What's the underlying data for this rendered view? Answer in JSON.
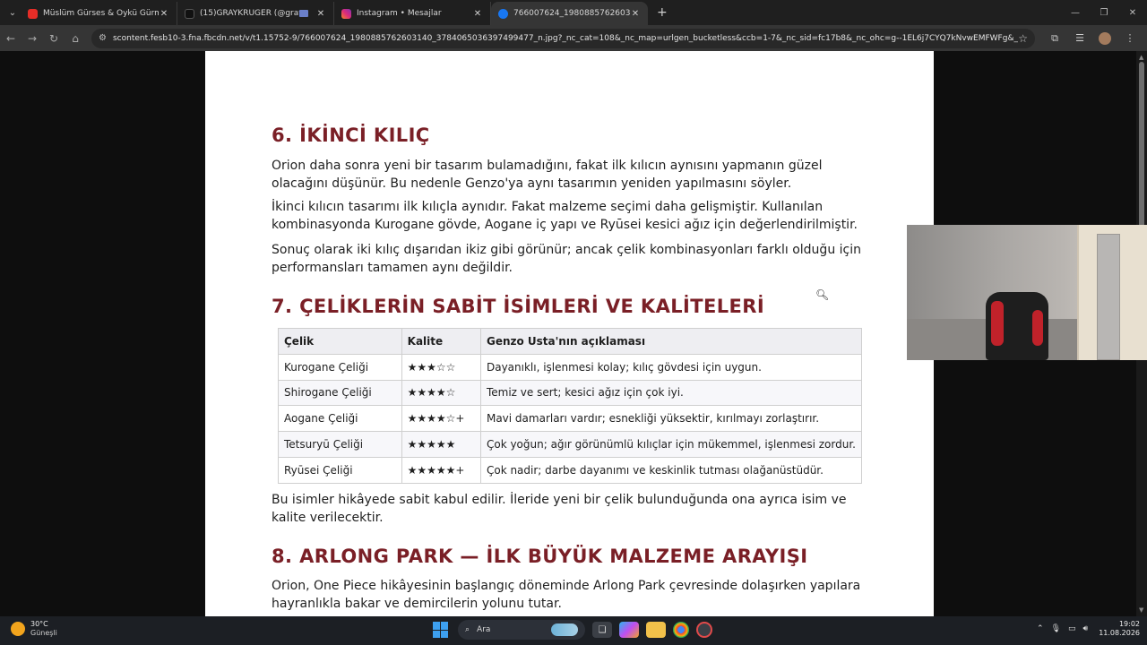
{
  "browser": {
    "tabs": [
      {
        "title": "Müslüm Gürses & Öykü Gürman",
        "favicon_color": "#e52d27",
        "active": false
      },
      {
        "title": "(15)GRAYKRUGER (@graykr",
        "favicon_color": "#111111",
        "active": false
      },
      {
        "title": "Instagram • Mesajlar",
        "favicon_color": "#d6249f",
        "active": false
      },
      {
        "title": "766007624_1980885762603140",
        "favicon_color": "#1877f2",
        "active": true
      }
    ],
    "close_glyph": "✕",
    "new_tab_glyph": "+",
    "url": "scontent.fesb10-3.fna.fbcdn.net/v/t1.15752-9/766007624_1980885762603140_3784065036397499477_n.jpg?_nc_cat=108&_nc_map=urlgen_bucketless&ccb=1-7&_nc_sid=fc17b8&_nc_ohc=g--1EL6j7CYQ7kNvwEMFWFg&_nc_oc=Adqb3Za8h9..."
  },
  "document": {
    "heading6": "6. İKİNCİ KILIÇ",
    "para6a": "Orion daha sonra yeni bir tasarım bulamadığını, fakat ilk kılıcın aynısını yapmanın güzel olacağını düşünür. Bu nedenle Genzo'ya aynı tasarımın yeniden yapılmasını söyler.",
    "para6b": "İkinci kılıcın tasarımı ilk kılıçla aynıdır. Fakat malzeme seçimi daha gelişmiştir. Kullanılan kombinasyonda Kurogane gövde, Aogane iç yapı ve Ryūsei kesici ağız için değerlendirilmiştir.",
    "para6c": "Sonuç olarak iki kılıç dışarıdan ikiz gibi görünür; ancak çelik kombinasyonları farklı olduğu için performansları tamamen aynı değildir.",
    "heading7": "7. ÇELİKLERİN SABİT İSİMLERİ VE KALİTELERİ",
    "table": {
      "headers": [
        "Çelik",
        "Kalite",
        "Genzo Usta'nın açıklaması"
      ],
      "rows": [
        [
          "Kurogane Çeliği",
          "★★★☆☆",
          "Dayanıklı, işlenmesi kolay; kılıç gövdesi için uygun."
        ],
        [
          "Shirogane Çeliği",
          "★★★★☆",
          "Temiz ve sert; kesici ağız için çok iyi."
        ],
        [
          "Aogane Çeliği",
          "★★★★☆+",
          "Mavi damarları vardır; esnekliği yüksektir, kırılmayı zorlaştırır."
        ],
        [
          "Tetsuryū Çeliği",
          "★★★★★",
          "Çok yoğun; ağır görünümlü kılıçlar için mükemmel, işlenmesi zordur."
        ],
        [
          "Ryūsei Çeliği",
          "★★★★★+",
          "Çok nadir; darbe dayanımı ve keskinlik tutması olağanüstüdür."
        ]
      ]
    },
    "para7": "Bu isimler hikâyede sabit kabul edilir. İleride yeni bir çelik bulunduğunda ona ayrıca isim ve kalite verilecektir.",
    "heading8": "8. ARLONG PARK — İLK BÜYÜK MALZEME ARAYIŞI",
    "para8": "Orion, One Piece hikâyesinin başlangıç döneminde Arlong Park çevresinde dolaşırken yapılara hayranlıkla bakar ve demircilerin yolunu tutar."
  },
  "taskbar": {
    "temperature": "30°C",
    "weather": "Güneşli",
    "search_label": "Ara",
    "time": "19:02",
    "date": "11.08.2026"
  },
  "colors": {
    "heading": "#7a1f26",
    "page_bg": "#ffffff",
    "viewer_bg": "#0e0e0e"
  }
}
